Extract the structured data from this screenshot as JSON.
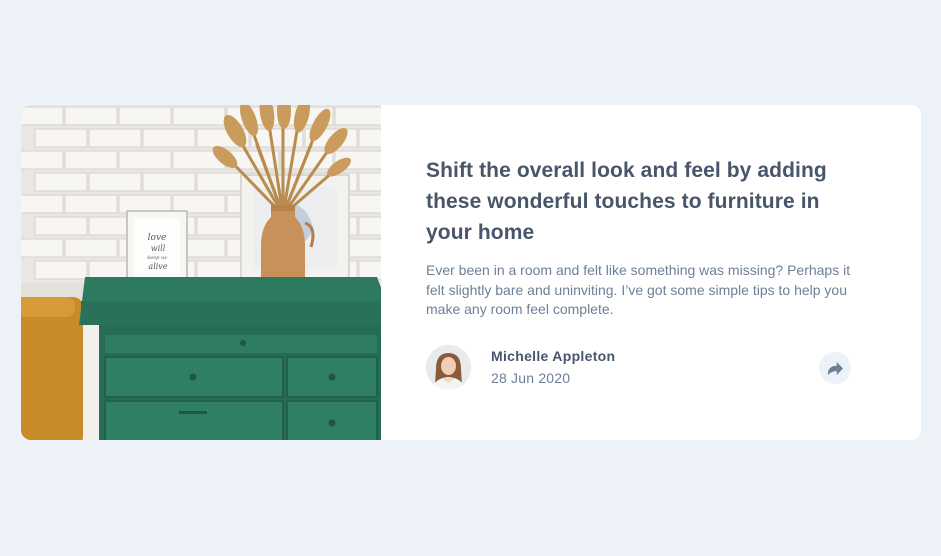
{
  "article": {
    "image_alt": "Green drawers",
    "title": "Shift the overall look and feel by adding these wonderful touches to furniture in your home",
    "excerpt": "Ever been in a room and felt like something was missing? Perhaps it felt slightly bare and uninviting. I’ve got some simple tips to help you make any room feel complete.",
    "frame_text": "love will keep us alive"
  },
  "author": {
    "name": "Michelle Appleton",
    "date": "28 Jun 2020"
  },
  "share": {
    "icon": "share-icon"
  },
  "colors": {
    "background": "#ecf2f8",
    "card": "#ffffff",
    "title": "#48556a",
    "text": "#6e8098",
    "share_bg": "#ecf2f8",
    "share_icon": "#6e8098",
    "drawer_green": "#2f7a62"
  }
}
